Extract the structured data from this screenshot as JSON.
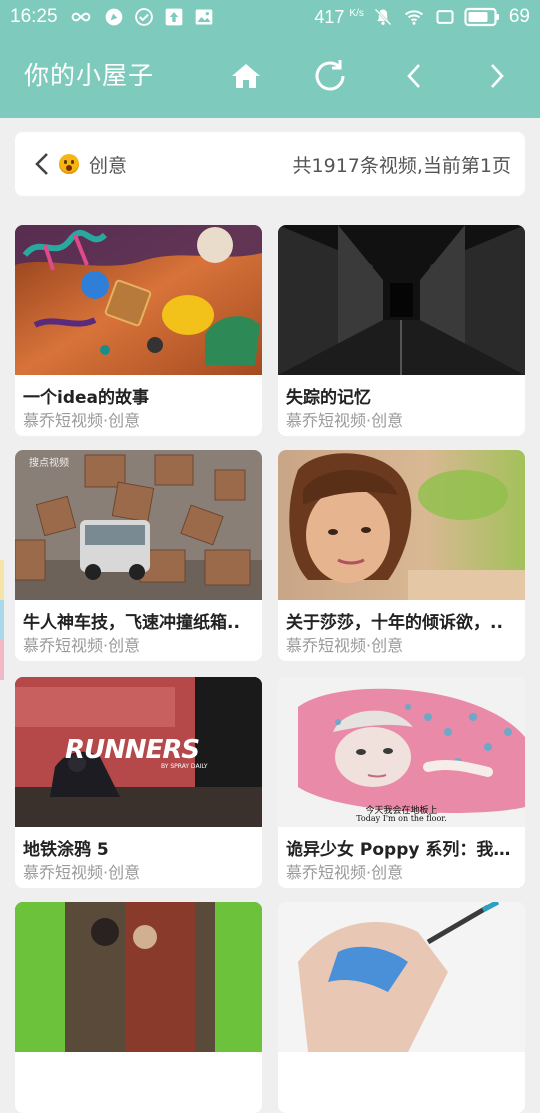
{
  "status_bar": {
    "time": "16:25",
    "net_speed": "417",
    "net_unit": "K/s",
    "battery": "69"
  },
  "app_bar": {
    "title": "你的小屋子",
    "home_icon": "home-icon",
    "refresh_icon": "refresh-icon",
    "prev_icon": "chevron-left-icon",
    "next_icon": "chevron-right-icon"
  },
  "category": {
    "name": "创意",
    "summary": "共1917条视频,当前第1页"
  },
  "videos": [
    {
      "title": "一个idea的故事",
      "source": "慕乔短视频·创意"
    },
    {
      "title": "失踪的记忆",
      "source": "慕乔短视频·创意"
    },
    {
      "title": "牛人神车技，飞速冲撞纸箱..",
      "source": "慕乔短视频·创意",
      "watermark": "搜点视频"
    },
    {
      "title": "关于莎莎，十年的倾诉欲，..",
      "source": "慕乔短视频·创意"
    },
    {
      "title": "地铁涂鸦 5",
      "source": "慕乔短视频·创意",
      "overlay": "RUNNERS",
      "overlay_sub": "BY SPRAY DAILY"
    },
    {
      "title": "诡异少女 Poppy 系列：我在..",
      "source": "慕乔短视频·创意",
      "caption_cn": "今天我会在地板上",
      "caption_en": "Today I'm on the floor."
    },
    {
      "title": "",
      "source": ""
    },
    {
      "title": "",
      "source": ""
    }
  ],
  "colors": {
    "accent": "#7ecbbd",
    "background": "#efefef",
    "card": "#ffffff",
    "subtitle": "#9a9a9a"
  }
}
